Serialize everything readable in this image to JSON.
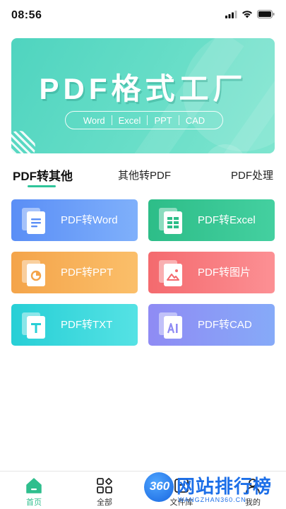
{
  "status_bar": {
    "time": "08:56"
  },
  "banner": {
    "title": "PDF格式工厂",
    "formats": [
      "Word",
      "Excel",
      "PPT",
      "CAD"
    ]
  },
  "tabs": [
    {
      "label": "PDF转其他",
      "active": true
    },
    {
      "label": "其他转PDF",
      "active": false
    },
    {
      "label": "PDF处理",
      "active": false
    }
  ],
  "tools": [
    {
      "label": "PDF转Word",
      "icon": "word-doc-icon",
      "color": "#5a8ef6"
    },
    {
      "label": "PDF转Excel",
      "icon": "excel-sheet-icon",
      "color": "#2dbd88"
    },
    {
      "label": "PDF转PPT",
      "icon": "ppt-pie-icon",
      "color": "#f4a44a"
    },
    {
      "label": "PDF转图片",
      "icon": "image-icon",
      "color": "#f46a6e"
    },
    {
      "label": "PDF转TXT",
      "icon": "txt-icon",
      "color": "#27cfd6"
    },
    {
      "label": "PDF转CAD",
      "icon": "cad-icon",
      "color": "#8f8bf4"
    }
  ],
  "bottom_nav": [
    {
      "label": "首页",
      "icon": "home-icon",
      "active": true
    },
    {
      "label": "全部",
      "icon": "grid-icon",
      "active": false
    },
    {
      "label": "文件库",
      "icon": "folder-icon",
      "active": false
    },
    {
      "label": "我的",
      "icon": "user-icon",
      "active": false
    }
  ],
  "watermark": {
    "badge": "360",
    "title": "网站排行榜",
    "subtitle": "WANGZHAN360.CN"
  },
  "colors": {
    "accent": "#2fc59a",
    "banner": "#5fdac4"
  }
}
